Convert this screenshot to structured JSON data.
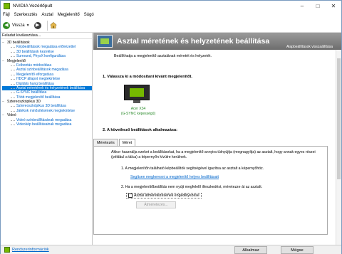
{
  "window": {
    "title": "NVIDIA Vezérlőpult"
  },
  "menu": [
    "Fájl",
    "Szerkesztés",
    "Asztal",
    "Megjelenítő",
    "Súgó"
  ],
  "toolbar": {
    "back_label": "Vissza"
  },
  "left_panel": {
    "header": "Feladat kiválasztása...",
    "tree": [
      {
        "label": "3D beállítások",
        "type": "cat"
      },
      {
        "label": "Képbeállítások megadása előnézettel",
        "type": "item"
      },
      {
        "label": "3D beállítások kezelése",
        "type": "item"
      },
      {
        "label": "Surround, PhysX konfigurálása",
        "type": "item"
      },
      {
        "label": "Megjelenítő",
        "type": "cat"
      },
      {
        "label": "Felbontás módosítása",
        "type": "item"
      },
      {
        "label": "Asztal színbeállítások megadása",
        "type": "item"
      },
      {
        "label": "Megjelenítő elforgatása",
        "type": "item"
      },
      {
        "label": "HDCP állapot megtekintése",
        "type": "item"
      },
      {
        "label": "Digitális hang beállítása",
        "type": "item"
      },
      {
        "label": "Asztal méretének és helyzetének beállítása",
        "type": "item",
        "selected": true
      },
      {
        "label": "G-SYNC beállítása",
        "type": "item"
      },
      {
        "label": "Több megjelenítő beállítása",
        "type": "item"
      },
      {
        "label": "Sztereoszkópikus 3D",
        "type": "cat"
      },
      {
        "label": "Sztereoszkópikus 3D beállítása",
        "type": "item"
      },
      {
        "label": "Játékok minősítésének megtekintése",
        "type": "item"
      },
      {
        "label": "Videó",
        "type": "cat"
      },
      {
        "label": "Videó színbeállításának megadása",
        "type": "item"
      },
      {
        "label": "Videokép beállításainak megadása",
        "type": "item"
      }
    ]
  },
  "main": {
    "title": "Asztal méretének és helyzetének beállítása",
    "restore_defaults": "Alapbeállítások visszaállítása",
    "description": "Beállíthatja a megjelenítő asztalának méretét és helyzetét.",
    "section1": "1. Válassza ki a módosítani kívánt megjelenítőt.",
    "display_name": "Acer X34",
    "display_sub": "(G-SYNC képességű)",
    "section2": "2. A következő beállítások alkalmazása:",
    "tabs": [
      "Méretezés",
      "Méret"
    ],
    "notice": "Akkor használja ezeket a beállításokat, ha a megjelenítő annyira túlnyújtja (megnagyítja) az asztalt, hogy annak egyes részei (például a tálca) a képernyőn kívülre kerülnek.",
    "step1": "1. A megjelenítőn található képbeállítók segítségével igazítsa az asztalt a képernyőhöz.",
    "link": "Segítsen megkeresni a megjelenítő helyes beállításait",
    "step2": "2. Ha a megjelenítőbeállítás nem nyújt megfelelő illeszkedést, méretezze át az asztalt.",
    "checkbox_label": "Asztal átméretezésének engedélyezése",
    "resize_button": "Átméretezés..."
  },
  "status": {
    "sysinfo": "Rendszerinformációk",
    "apply": "Alkalmaz",
    "cancel": "Mégse"
  },
  "colors": {
    "nvidia_green": "#76b900",
    "selection": "#0078d7",
    "link": "#0066cc"
  }
}
